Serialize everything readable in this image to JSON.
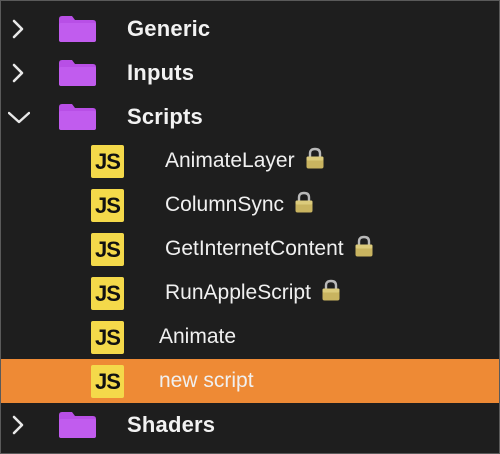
{
  "tree": {
    "folders": {
      "generic": {
        "label": "Generic",
        "expanded": false
      },
      "inputs": {
        "label": "Inputs",
        "expanded": false
      },
      "scripts": {
        "label": "Scripts",
        "expanded": true
      },
      "shaders": {
        "label": "Shaders",
        "expanded": false
      }
    },
    "scripts": [
      {
        "icon_text": "JS",
        "label": "AnimateLayer",
        "locked": true
      },
      {
        "icon_text": "JS",
        "label": "ColumnSync",
        "locked": true
      },
      {
        "icon_text": "JS",
        "label": "GetInternetContent",
        "locked": true
      },
      {
        "icon_text": "JS",
        "label": "RunAppleScript",
        "locked": true
      },
      {
        "icon_text": "JS",
        "label": "Animate",
        "locked": false
      },
      {
        "icon_text": "JS",
        "label": "new script",
        "locked": false,
        "selected": true
      }
    ]
  },
  "colors": {
    "background": "#1e1e1e",
    "folder": "#b84fe6",
    "js_badge": "#f4d94a",
    "selection": "#ee8a35",
    "text": "#f2f2f2"
  },
  "icons": {
    "folder": "folder-icon",
    "js_file": "javascript-file-icon",
    "lock": "lock-icon",
    "collapsed": "chevron-right-icon",
    "expanded": "chevron-down-icon"
  }
}
